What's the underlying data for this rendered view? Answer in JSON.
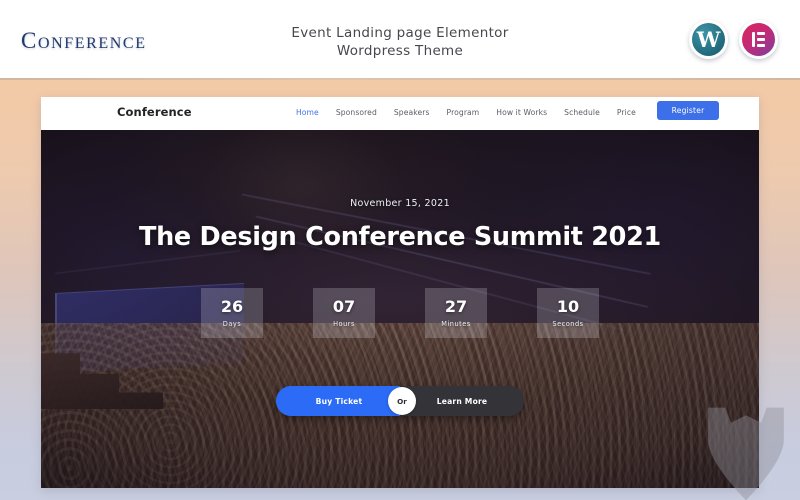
{
  "header": {
    "logo_text": "Conference",
    "title_line1": "Event Landing page Elementor",
    "title_line2": "Wordpress Theme",
    "badges": [
      {
        "name": "wordpress-badge",
        "glyph": "W"
      },
      {
        "name": "elementor-badge",
        "glyph": "E"
      }
    ]
  },
  "site": {
    "brand": "Conference",
    "menu": [
      {
        "label": "Home",
        "active": true
      },
      {
        "label": "Sponsored",
        "active": false
      },
      {
        "label": "Speakers",
        "active": false
      },
      {
        "label": "Program",
        "active": false
      },
      {
        "label": "How it Works",
        "active": false
      },
      {
        "label": "Schedule",
        "active": false
      },
      {
        "label": "Price",
        "active": false
      }
    ],
    "register_label": "Register",
    "hero": {
      "date": "November 15, 2021",
      "title": "The Design Conference Summit 2021",
      "countdown": [
        {
          "value": "26",
          "label": "Days"
        },
        {
          "value": "07",
          "label": "Hours"
        },
        {
          "value": "27",
          "label": "Minutes"
        },
        {
          "value": "10",
          "label": "Seconds"
        }
      ],
      "cta_primary": "Buy Ticket",
      "cta_divider": "Or",
      "cta_secondary": "Learn More"
    }
  },
  "colors": {
    "accent_blue": "#3c6fe8",
    "cta_blue": "#2b6bf5",
    "cta_dark": "#333338",
    "logo_navy": "#223a6b",
    "bg_top": "#f3caa6",
    "bg_bottom": "#c9cee0",
    "elementor_pink": "#d6255f",
    "wordpress_teal": "#20697c"
  }
}
